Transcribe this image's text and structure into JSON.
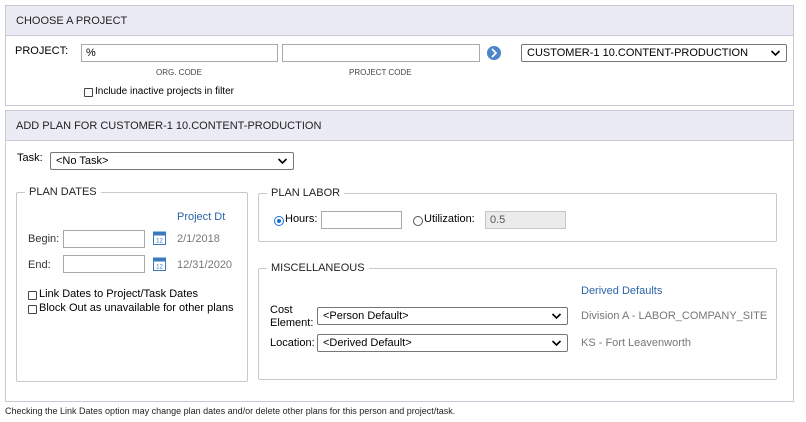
{
  "choose_project": {
    "title": "CHOOSE A PROJECT",
    "project_label": "PROJECT:",
    "org_code_value": "%",
    "org_code_caption": "ORG. CODE",
    "project_code_value": "",
    "project_code_caption": "PROJECT CODE",
    "project_select": "CUSTOMER-1 10.CONTENT-PRODUCTION",
    "include_inactive_label": "Include inactive projects in filter"
  },
  "add_plan": {
    "title": "ADD PLAN FOR CUSTOMER-1 10.CONTENT-PRODUCTION",
    "task_label": "Task:",
    "task_select": "<No Task>",
    "plan_dates": {
      "legend": "PLAN DATES",
      "project_dt_header": "Project Dt",
      "begin_label": "Begin:",
      "begin_value": "",
      "begin_project_dt": "2/1/2018",
      "end_label": "End:",
      "end_value": "",
      "end_project_dt": "12/31/2020",
      "link_dates_label": "Link Dates to Project/Task Dates",
      "block_out_label": "Block Out as unavailable for other plans"
    },
    "plan_labor": {
      "legend": "PLAN LABOR",
      "hours_label": "Hours:",
      "hours_value": "",
      "utilization_label": "Utilization:",
      "utilization_value": "0.5"
    },
    "misc": {
      "legend": "MISCELLANEOUS",
      "derived_defaults_header": "Derived Defaults",
      "cost_element_label_1": "Cost",
      "cost_element_label_2": "Element:",
      "cost_element_select": "<Person Default>",
      "cost_element_derived": "Division A - LABOR_COMPANY_SITE",
      "location_label": "Location:",
      "location_select": "<Derived Default>",
      "location_derived": "KS - Fort Leavenworth"
    }
  },
  "footer_note": "Checking the Link Dates option may change plan dates and/or delete other plans for this person and project/task.",
  "colors": {
    "header_bg": "#ebebf5",
    "accent_blue": "#2a64a8",
    "radio_blue": "#1a6fd6"
  }
}
